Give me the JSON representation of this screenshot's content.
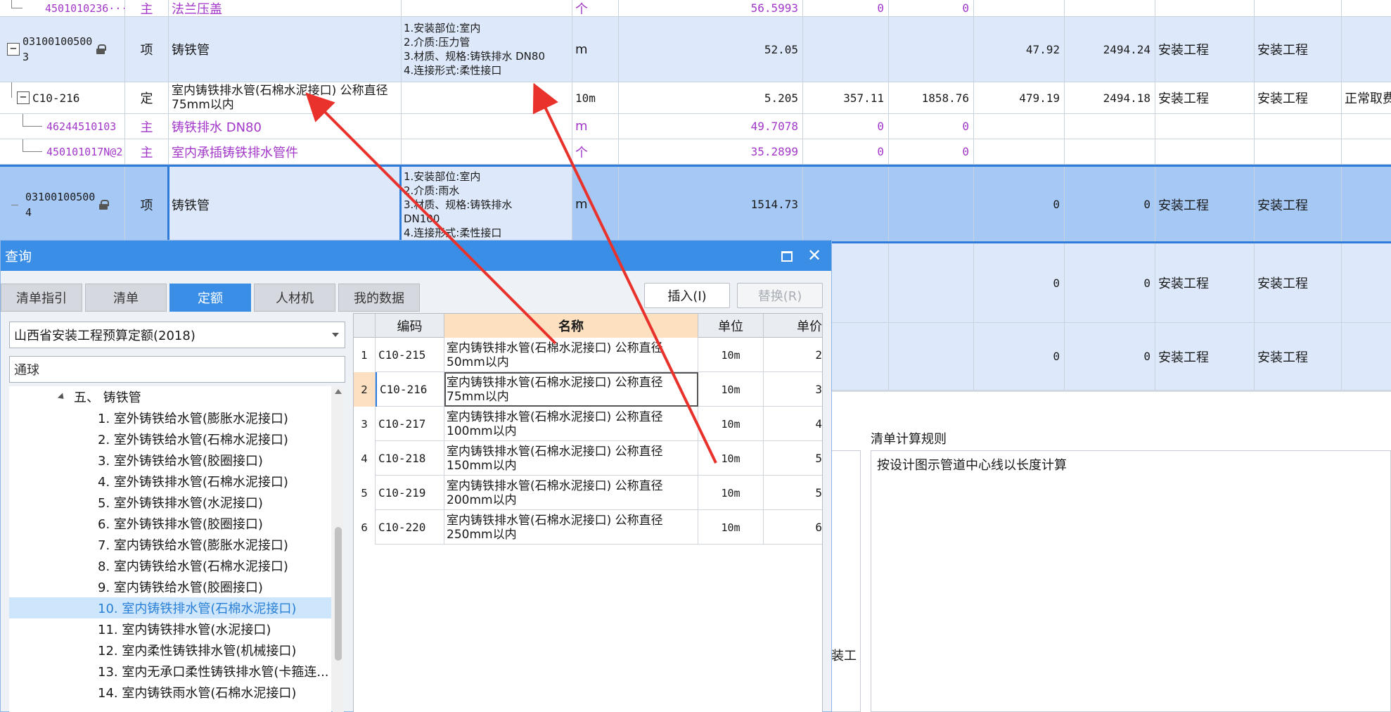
{
  "grid": {
    "rows": [
      {
        "code": "4501010236···",
        "type": "主",
        "name": "法兰压盖",
        "feature": [],
        "unit": "个",
        "qty": "56.5993",
        "c1": "0",
        "c2": "0",
        "c3": "",
        "c4": "",
        "c5": "",
        "c6": "",
        "c7": ""
      },
      {
        "code_line1": "03100100500",
        "code_line2": "3",
        "type": "项",
        "name": "铸铁管",
        "feature": [
          "1.安装部位:室内",
          "2.介质:压力管",
          "3.材质、规格:铸铁排水 DN80",
          "4.连接形式:柔性接口"
        ],
        "unit": "m",
        "qty": "52.05",
        "c1": "",
        "c2": "",
        "c3": "47.92",
        "c4": "2494.24",
        "c5": "安装工程",
        "c6": "安装工程",
        "c7": ""
      },
      {
        "code": "C10-216",
        "type": "定",
        "name": "室内铸铁排水管(石棉水泥接口) 公称直径75mm以内",
        "feature": [],
        "unit": "10m",
        "qty": "5.205",
        "c1": "357.11",
        "c2": "1858.76",
        "c3": "479.19",
        "c4": "2494.18",
        "c5": "安装工程",
        "c6": "安装工程",
        "c7": "正常取费"
      },
      {
        "code": "46244510103",
        "type": "主",
        "name": "铸铁排水 DN80",
        "feature": [],
        "unit": "m",
        "qty": "49.7078",
        "c1": "0",
        "c2": "0",
        "c3": "",
        "c4": "",
        "c5": "",
        "c6": "",
        "c7": ""
      },
      {
        "code": "450101017N@2",
        "type": "主",
        "name": "室内承插铸铁排水管件",
        "feature": [],
        "unit": "个",
        "qty": "35.2899",
        "c1": "0",
        "c2": "0",
        "c3": "",
        "c4": "",
        "c5": "",
        "c6": "",
        "c7": ""
      },
      {
        "code_line1": "03100100500",
        "code_line2": "4",
        "type": "项",
        "name": "铸铁管",
        "feature": [
          "1.安装部位:室内",
          "2.介质:雨水",
          "3.材质、规格:铸铁排水",
          "DN100",
          "4.连接形式:柔性接口"
        ],
        "unit": "m",
        "qty": "1514.73",
        "c1": "",
        "c2": "",
        "c3": "0",
        "c4": "0",
        "c5": "安装工程",
        "c6": "安装工程",
        "c7": ""
      },
      {
        "c3": "0",
        "c4": "0",
        "c5": "安装工程",
        "c6": "安装工程"
      },
      {
        "c3": "0",
        "c4": "0",
        "c5": "安装工程",
        "c6": "安装工程"
      }
    ],
    "lower": {
      "rule_title": "清单计算规则",
      "rule_text": "按设计图示管道中心线以长度计算",
      "left_fragment": "装工"
    }
  },
  "dialog": {
    "title": "查询",
    "tabs": [
      "清单指引",
      "清单",
      "定额",
      "人材机",
      "我的数据"
    ],
    "active_tab": 2,
    "insert_label": "插入(I)",
    "replace_label": "替换(R)",
    "library": "山西省安装工程预算定额(2018)",
    "search_value": "通球",
    "tree": {
      "section": "五、 铸铁管",
      "items": [
        "1. 室外铸铁给水管(膨胀水泥接口)",
        "2. 室外铸铁给水管(石棉水泥接口)",
        "3. 室外铸铁给水管(胶圈接口)",
        "4. 室外铸铁排水管(石棉水泥接口)",
        "5. 室外铸铁排水管(水泥接口)",
        "6. 室外铸铁排水管(胶圈接口)",
        "7. 室内铸铁给水管(膨胀水泥接口)",
        "8. 室内铸铁给水管(石棉水泥接口)",
        "9. 室内铸铁给水管(胶圈接口)",
        "10. 室内铸铁排水管(石棉水泥接口)",
        "11. 室内铸铁排水管(水泥接口)",
        "12. 室内柔性铸铁排水管(机械接口)",
        "13. 室内无承口柔性铸铁排水管(卡箍连...",
        "14. 室内铸铁雨水管(石棉水泥接口)"
      ],
      "selected_index": 9
    },
    "table": {
      "headers": [
        "",
        "编码",
        "名称",
        "单位",
        "单价"
      ],
      "rows": [
        {
          "idx": "1",
          "code": "C10-215",
          "name_l1": "室内铸铁排水管(石棉水泥接口) 公称直径",
          "name_l2": "50mm以内",
          "unit": "10m",
          "price": "2"
        },
        {
          "idx": "2",
          "code": "C10-216",
          "name_l1": "室内铸铁排水管(石棉水泥接口) 公称直径",
          "name_l2": "75mm以内",
          "unit": "10m",
          "price": "3"
        },
        {
          "idx": "3",
          "code": "C10-217",
          "name_l1": "室内铸铁排水管(石棉水泥接口) 公称直径",
          "name_l2": "100mm以内",
          "unit": "10m",
          "price": "4"
        },
        {
          "idx": "4",
          "code": "C10-218",
          "name_l1": "室内铸铁排水管(石棉水泥接口) 公称直径",
          "name_l2": "150mm以内",
          "unit": "10m",
          "price": "5"
        },
        {
          "idx": "5",
          "code": "C10-219",
          "name_l1": "室内铸铁排水管(石棉水泥接口) 公称直径",
          "name_l2": "200mm以内",
          "unit": "10m",
          "price": "5"
        },
        {
          "idx": "6",
          "code": "C10-220",
          "name_l1": "室内铸铁排水管(石棉水泥接口) 公称直径",
          "name_l2": "250mm以内",
          "unit": "10m",
          "price": "6"
        }
      ],
      "current_row": 1
    }
  },
  "colors": {
    "accent": "#3a8ee6",
    "annotation_arrow": "#e8322b",
    "material_text": "#a237c9",
    "item_row_bg": "#dde9fb",
    "selected_row_bg": "#a6c8f5"
  }
}
